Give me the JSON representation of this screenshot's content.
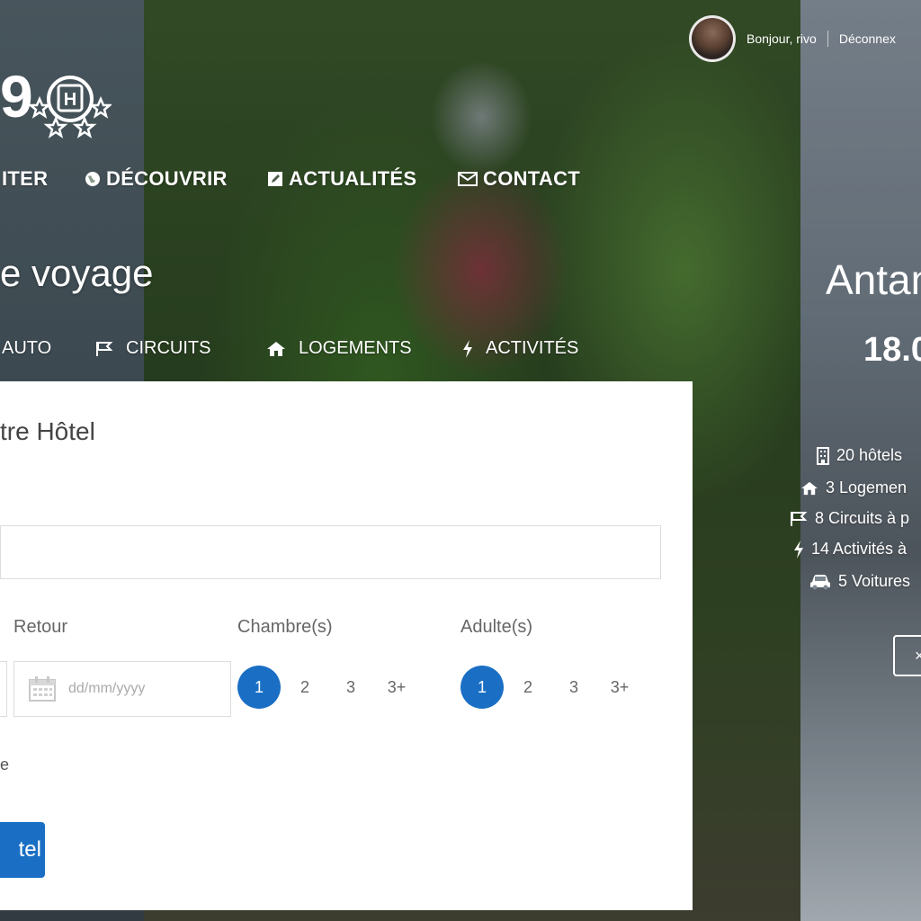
{
  "logo": {
    "number": "9",
    "badge_letter": "H"
  },
  "nav": [
    {
      "label": "ITER",
      "icon": "none"
    },
    {
      "label": "DÉCOUVRIR",
      "icon": "globe-icon"
    },
    {
      "label": "ACTUALITÉS",
      "icon": "edit-icon"
    },
    {
      "label": "CONTACT",
      "icon": "envelope-icon"
    }
  ],
  "user": {
    "greeting": "Bonjour, rivo",
    "logout": "Déconnex"
  },
  "headline": "e voyage",
  "tabs": [
    {
      "label": "AUTO",
      "icon": "none"
    },
    {
      "label": "CIRCUITS",
      "icon": "flag-icon"
    },
    {
      "label": "LOGEMENTS",
      "icon": "home-icon"
    },
    {
      "label": "ACTIVITÉS",
      "icon": "bolt-icon"
    }
  ],
  "search_panel": {
    "title": "tre Hôtel",
    "top_label": "",
    "destination_value": "",
    "return_label": "Retour",
    "date_placeholder": "dd/mm/yyyy",
    "rooms_label": "Chambre(s)",
    "adults_label": "Adulte(s)",
    "rooms_options": [
      "1",
      "2",
      "3",
      "3+"
    ],
    "rooms_selected": "1",
    "adults_options": [
      "1",
      "2",
      "3",
      "3+"
    ],
    "adults_selected": "1",
    "small_text": "e",
    "submit_label": "tel"
  },
  "promo": {
    "city": "Antan",
    "price": "18.0",
    "stats": [
      {
        "icon": "building-icon",
        "text": "20 hôtels"
      },
      {
        "icon": "home-icon",
        "text": "3 Logemen"
      },
      {
        "icon": "flag-icon",
        "text": "8 Circuits à p"
      },
      {
        "icon": "bolt-icon",
        "text": "14 Activités à"
      },
      {
        "icon": "car-icon",
        "text": "5 Voitures"
      }
    ],
    "more_label": "×"
  },
  "colors": {
    "accent": "#1a6fc4",
    "panel_bg": "#ffffff",
    "text_dark": "#444444"
  }
}
